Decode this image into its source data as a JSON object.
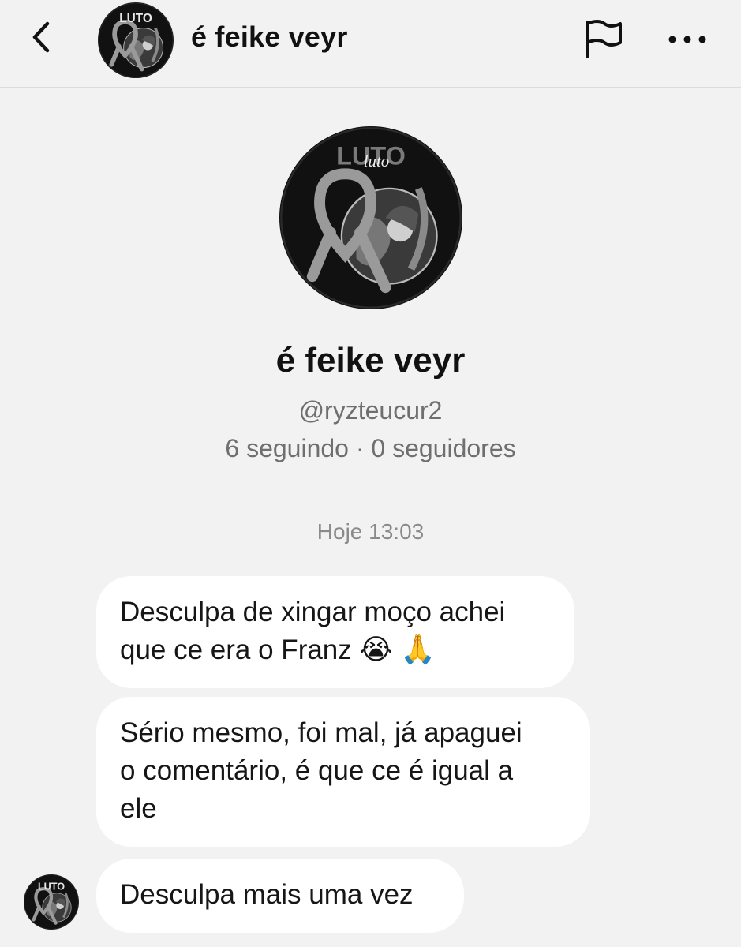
{
  "header": {
    "title": "é feike veyr",
    "icons": {
      "back": "chevron-left-icon",
      "report": "flag-icon",
      "more": "more-horizontal-icon"
    }
  },
  "profile": {
    "name": "é feike veyr",
    "handle": "@ryzteucur2",
    "stats": "6 seguindo · 0 seguidores",
    "avatar_text_top": "LUTO",
    "avatar_text_script": "luto"
  },
  "conversation": {
    "timestamp": "Hoje 13:03",
    "messages": [
      {
        "lines": [
          "Desculpa de xingar moço achei",
          "que ce era o Franz"
        ],
        "emojis": [
          "😭",
          "🙏"
        ]
      },
      {
        "lines": [
          "Sério mesmo, foi mal, já apaguei",
          "o comentário, é que ce é igual a",
          "ele"
        ]
      },
      {
        "lines": [
          "Desculpa mais uma vez"
        ]
      }
    ]
  },
  "colors": {
    "background": "#f2f2f2",
    "bubble": "#ffffff",
    "muted_text": "#6f6f6f",
    "avatar_bg": "#111111"
  }
}
